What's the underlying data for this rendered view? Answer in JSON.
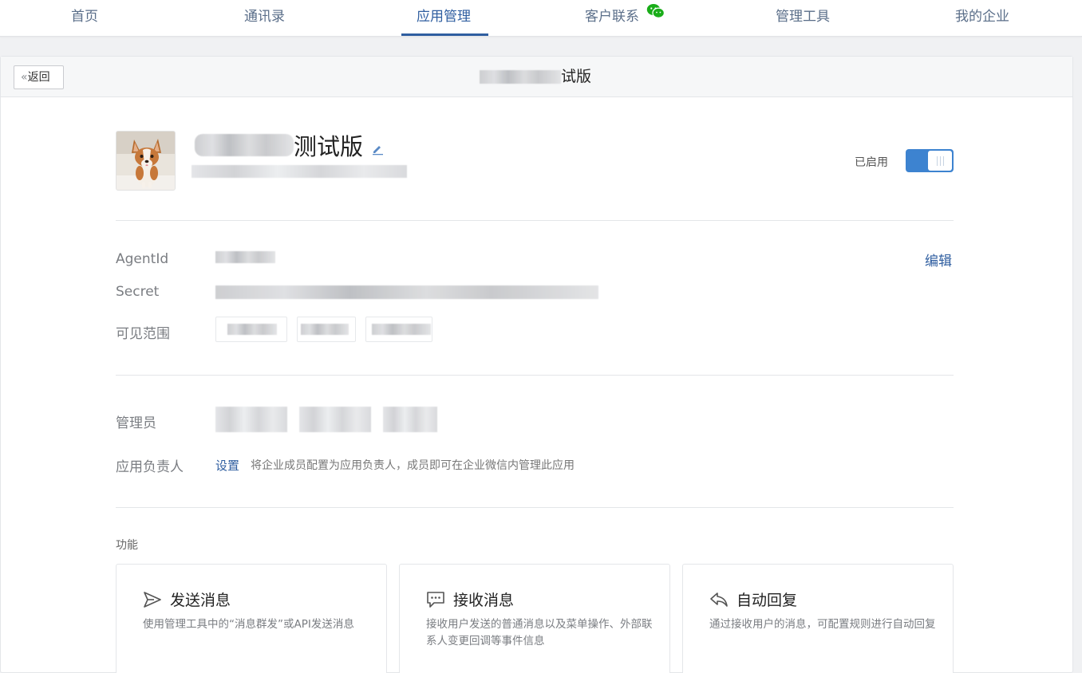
{
  "nav": {
    "items": [
      {
        "label": "首页"
      },
      {
        "label": "通讯录"
      },
      {
        "label": "应用管理"
      },
      {
        "label": "客户联系"
      },
      {
        "label": "管理工具"
      },
      {
        "label": "我的企业"
      }
    ],
    "active_index": 2,
    "accent_color": "#2f5ea0"
  },
  "header": {
    "back_label": "返回",
    "title_suffix": "试版"
  },
  "app": {
    "name_suffix": "测试版",
    "status_label": "已启用",
    "enabled": true,
    "toggle_color": "#3d83d0"
  },
  "fields": {
    "agentid_label": "AgentId",
    "secret_label": "Secret",
    "scope_label": "可见范围",
    "edit_label": "编辑",
    "admin_label": "管理员",
    "owner_label": "应用负责人",
    "owner_set_label": "设置",
    "owner_hint": "将企业成员配置为应用负责人，成员即可在企业微信内管理此应用"
  },
  "features": {
    "section_title": "功能",
    "cards": [
      {
        "icon": "send-icon",
        "title": "发送消息",
        "desc": "使用管理工具中的“消息群发”或API发送消息"
      },
      {
        "icon": "chat-bubble-icon",
        "title": "接收消息",
        "desc": "接收用户发送的普通消息以及菜单操作、外部联系人变更回调等事件信息"
      },
      {
        "icon": "reply-icon",
        "title": "自动回复",
        "desc": "通过接收用户的消息，可配置规则进行自动回复"
      }
    ]
  }
}
